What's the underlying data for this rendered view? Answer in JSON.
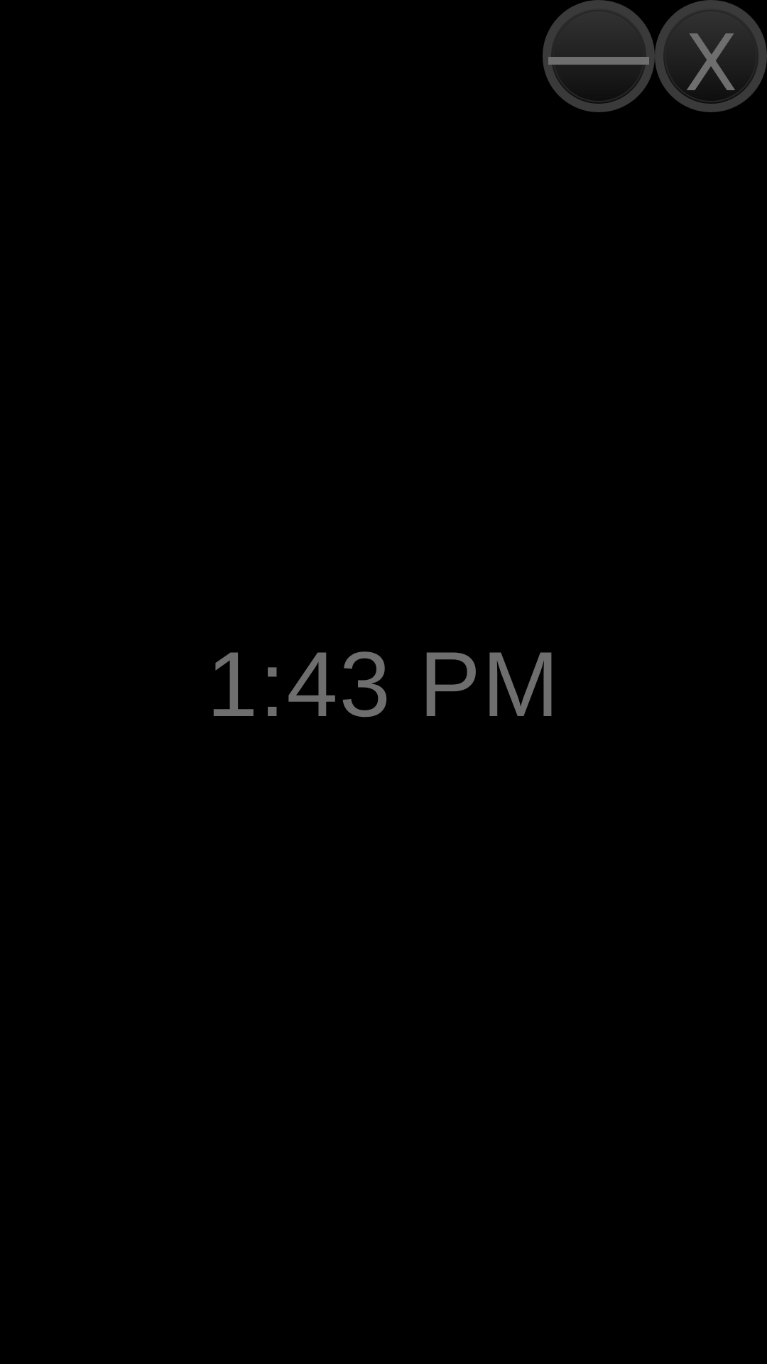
{
  "window_controls": {
    "minimize_icon": "minimize-icon",
    "close_label": "X",
    "close_icon": "close-icon"
  },
  "clock": {
    "time": "1:43 PM"
  },
  "colors": {
    "background": "#000000",
    "text": "#6e6e6e",
    "button_ring": "#3a3a3a"
  }
}
